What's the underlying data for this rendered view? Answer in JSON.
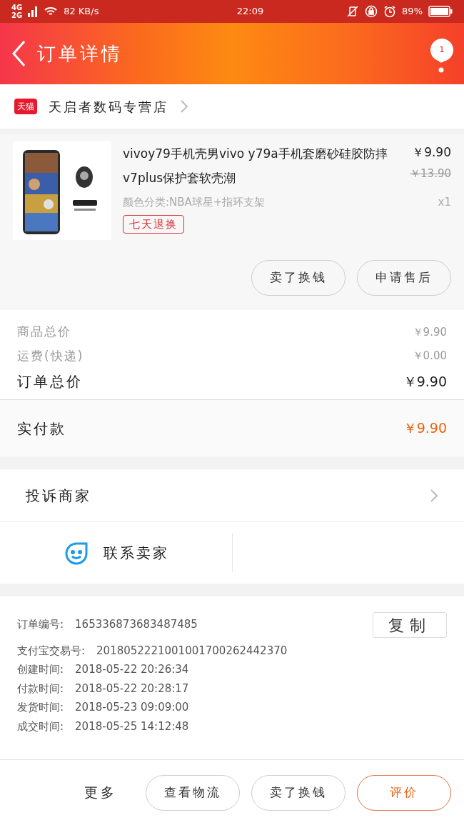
{
  "status_bar": {
    "network": [
      "4G",
      "2G"
    ],
    "speed": "82 KB/s",
    "time": "22:09",
    "battery": "89%"
  },
  "header": {
    "title": "订单详情",
    "badge": "1"
  },
  "store": {
    "badge": "天猫",
    "name": "天启者数码专营店"
  },
  "product": {
    "title": "vivoy79手机壳男vivo y79a手机套磨砂硅胶防摔v7plus保护套软壳潮",
    "price": "￥9.90",
    "original_price": "￥13.90",
    "variant": "颜色分类:NBA球星+指环支架",
    "quantity": "x1",
    "tag": "七天退换"
  },
  "product_actions": [
    "卖了换钱",
    "申请售后"
  ],
  "summary": {
    "rows": [
      {
        "label": "商品总价",
        "value": "￥9.90",
        "kind": "minor"
      },
      {
        "label": "运费(快递)",
        "value": "￥0.00",
        "kind": "minor"
      },
      {
        "label": "订单总价",
        "value": "￥9.90",
        "kind": "total"
      }
    ],
    "paid": {
      "label": "实付款",
      "value": "￥9.90"
    }
  },
  "complaint": {
    "label": "投诉商家"
  },
  "contact": {
    "label": "联系卖家"
  },
  "order_info": {
    "copy_button": "复制",
    "rows": [
      {
        "label": "订单编号:",
        "value": "165336873683487485"
      },
      {
        "label": "支付宝交易号:",
        "value": "2018052221001001700262442370"
      },
      {
        "label": "创建时间:",
        "value": "2018-05-22 20:26:34"
      },
      {
        "label": "付款时间:",
        "value": "2018-05-22 20:28:17"
      },
      {
        "label": "发货时间:",
        "value": "2018-05-23 09:09:00"
      },
      {
        "label": "成交时间:",
        "value": "2018-05-25 14:12:48"
      }
    ]
  },
  "bottom_bar": {
    "more": "更多",
    "buttons": [
      {
        "label": "查看物流",
        "kind": "normal"
      },
      {
        "label": "卖了换钱",
        "kind": "normal"
      },
      {
        "label": "评价",
        "kind": "primary"
      }
    ]
  }
}
